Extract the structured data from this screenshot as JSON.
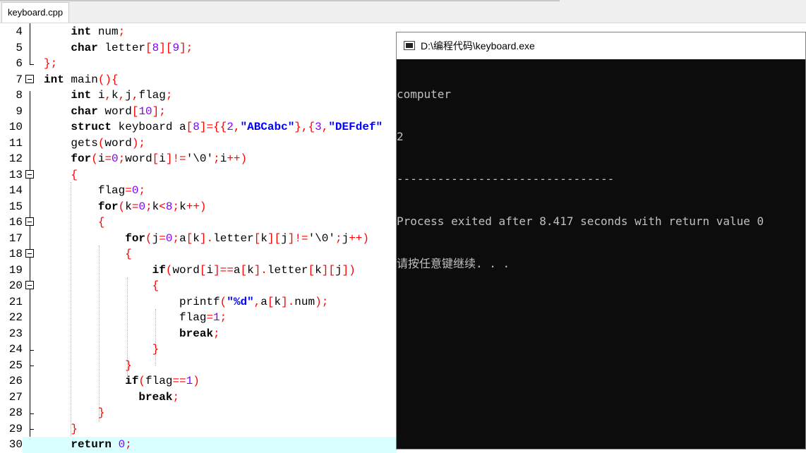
{
  "tab": {
    "label": "keyboard.cpp"
  },
  "editor": {
    "lines": [
      {
        "n": "4"
      },
      {
        "n": "5"
      },
      {
        "n": "6"
      },
      {
        "n": "7"
      },
      {
        "n": "8"
      },
      {
        "n": "9"
      },
      {
        "n": "10"
      },
      {
        "n": "11"
      },
      {
        "n": "12"
      },
      {
        "n": "13"
      },
      {
        "n": "14"
      },
      {
        "n": "15"
      },
      {
        "n": "16"
      },
      {
        "n": "17"
      },
      {
        "n": "18"
      },
      {
        "n": "19"
      },
      {
        "n": "20"
      },
      {
        "n": "21"
      },
      {
        "n": "22"
      },
      {
        "n": "23"
      },
      {
        "n": "24"
      },
      {
        "n": "25"
      },
      {
        "n": "26"
      },
      {
        "n": "27"
      },
      {
        "n": "28"
      },
      {
        "n": "29"
      },
      {
        "n": "30"
      }
    ]
  },
  "console": {
    "title": "D:\\编程代码\\keyboard.exe",
    "output": [
      "computer",
      "2",
      "--------------------------------",
      "Process exited after 8.417 seconds with return value 0",
      "请按任意键继续. . ."
    ]
  },
  "colors": {
    "keyword": "#000000",
    "operator": "#ff0000",
    "number": "#8000ff",
    "string": "#0000ff",
    "current_line": "#d9ffff",
    "console_bg": "#0c0c0c",
    "console_text": "#c0c0c0"
  }
}
